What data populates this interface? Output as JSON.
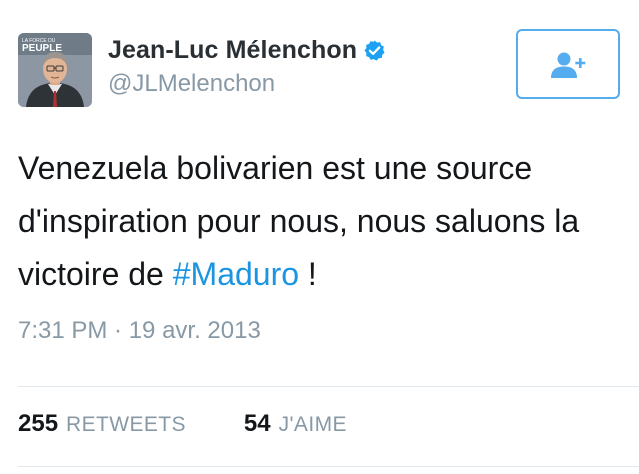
{
  "author": {
    "display_name": "Jean-Luc Mélenchon",
    "handle": "@JLMelenchon",
    "verified": true,
    "avatar_text_top": "LA FORCE DU",
    "avatar_text_bottom": "PEUPLE"
  },
  "follow_button": {
    "icon": "add-user-icon"
  },
  "tweet": {
    "text_before": "Venezuela bolivarien est une source d'inspiration pour nous, nous saluons la victoire de ",
    "hashtag": "#Maduro",
    "text_after": " !",
    "timestamp": "7:31 PM · 19 avr. 2013"
  },
  "stats": {
    "retweets_count": "255",
    "retweets_label": "RETWEETS",
    "likes_count": "54",
    "likes_label": "J'AIME"
  },
  "colors": {
    "accent": "#1b95e0",
    "follow_border": "#55acee",
    "muted": "#8899a6",
    "divider": "#e1e8ed"
  }
}
